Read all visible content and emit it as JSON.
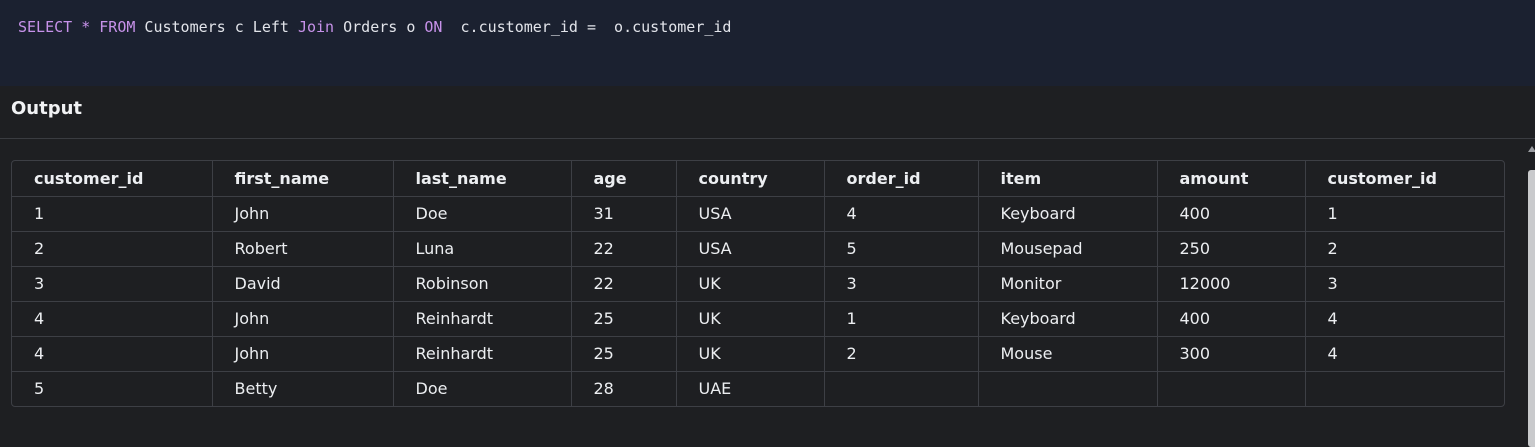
{
  "query": {
    "tokens": [
      {
        "text": "SELECT",
        "type": "keyword"
      },
      {
        "text": " ",
        "type": "plain"
      },
      {
        "text": "*",
        "type": "keyword"
      },
      {
        "text": " ",
        "type": "plain"
      },
      {
        "text": "FROM",
        "type": "keyword"
      },
      {
        "text": " Customers c Left ",
        "type": "plain"
      },
      {
        "text": "Join",
        "type": "keyword"
      },
      {
        "text": " Orders o ",
        "type": "plain"
      },
      {
        "text": "ON",
        "type": "keyword"
      },
      {
        "text": "  c.customer_id =  o.customer_id",
        "type": "plain"
      }
    ]
  },
  "output": {
    "title": "Output",
    "columns": [
      "customer_id",
      "first_name",
      "last_name",
      "age",
      "country",
      "order_id",
      "item",
      "amount",
      "customer_id"
    ],
    "rows": [
      [
        "1",
        "John",
        "Doe",
        "31",
        "USA",
        "4",
        "Keyboard",
        "400",
        "1"
      ],
      [
        "2",
        "Robert",
        "Luna",
        "22",
        "USA",
        "5",
        "Mousepad",
        "250",
        "2"
      ],
      [
        "3",
        "David",
        "Robinson",
        "22",
        "UK",
        "3",
        "Monitor",
        "12000",
        "3"
      ],
      [
        "4",
        "John",
        "Reinhardt",
        "25",
        "UK",
        "1",
        "Keyboard",
        "400",
        "4"
      ],
      [
        "4",
        "John",
        "Reinhardt",
        "25",
        "UK",
        "2",
        "Mouse",
        "300",
        "4"
      ],
      [
        "5",
        "Betty",
        "Doe",
        "28",
        "UAE",
        "",
        "",
        "",
        ""
      ]
    ]
  },
  "colors": {
    "keyword": "#c792ea",
    "editor_bg": "#1b2130",
    "page_bg": "#1e1f22"
  }
}
